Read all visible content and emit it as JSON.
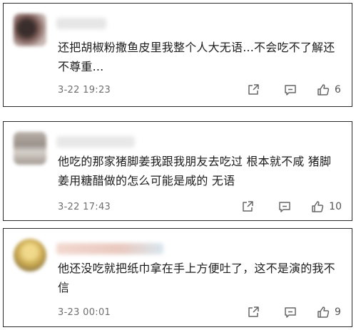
{
  "comments": [
    {
      "text": "还把胡椒粉撒鱼皮里我整个人大无语...不会吃不了解还不尊重...",
      "time": "3-22 19:23",
      "likes": "6"
    },
    {
      "text": "他吃的那家猪脚姜我跟我朋友去吃过 根本就不咸 猪脚姜用糖醋做的怎么可能是咸的 无语",
      "time": "3-22 17:43",
      "likes": "10"
    },
    {
      "text": "他还没吃就把纸巾拿在手上方便吐了，这不是演的我不信",
      "time": "3-23 00:01",
      "likes": "9"
    }
  ],
  "icons": {
    "share": "share-icon",
    "reply": "comment-icon",
    "like": "thumbs-up-icon"
  },
  "colors": {
    "card_border": "#2b2b2b",
    "text": "#1c1c1c",
    "meta": "#6e6e6e",
    "icon": "#666666"
  }
}
